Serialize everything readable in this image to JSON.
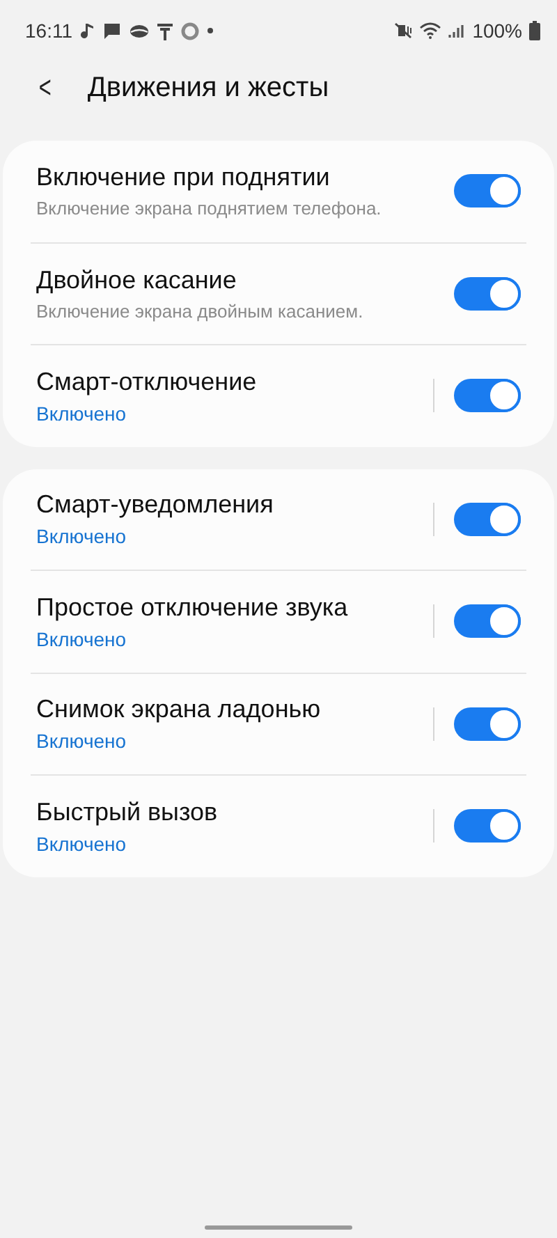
{
  "status_bar": {
    "time": "16:11",
    "battery": "100%"
  },
  "header": {
    "back": "<",
    "title": "Движения и жесты"
  },
  "groups": [
    {
      "items": [
        {
          "title": "Включение при поднятии",
          "subtitle": "Включение экрана поднятием телефона.",
          "kind": "description",
          "on": true,
          "divider": false
        },
        {
          "title": "Двойное касание",
          "subtitle": "Включение экрана двойным касанием.",
          "kind": "description",
          "on": true,
          "divider": false
        },
        {
          "title": "Смарт-отключение",
          "subtitle": "Включено",
          "kind": "status",
          "on": true,
          "divider": true
        }
      ]
    },
    {
      "items": [
        {
          "title": "Смарт-уведомления",
          "subtitle": "Включено",
          "kind": "status",
          "on": true,
          "divider": true
        },
        {
          "title": "Простое отключение звука",
          "subtitle": "Включено",
          "kind": "status",
          "on": true,
          "divider": true
        },
        {
          "title": "Снимок экрана ладонью",
          "subtitle": "Включено",
          "kind": "status",
          "on": true,
          "divider": true
        },
        {
          "title": "Быстрый вызов",
          "subtitle": "Включено",
          "kind": "status",
          "on": true,
          "divider": true
        }
      ]
    }
  ]
}
